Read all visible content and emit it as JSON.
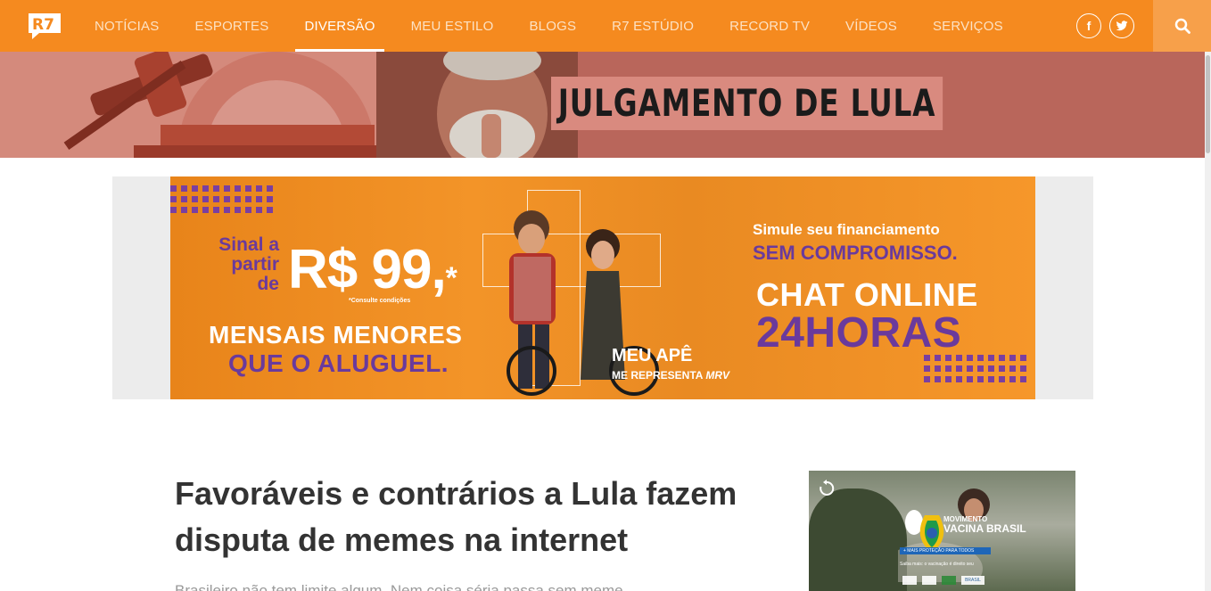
{
  "header": {
    "logo_text": "R7",
    "nav": [
      {
        "label": "NOTÍCIAS",
        "active": false
      },
      {
        "label": "ESPORTES",
        "active": false
      },
      {
        "label": "DIVERSÃO",
        "active": true
      },
      {
        "label": "MEU ESTILO",
        "active": false
      },
      {
        "label": "BLOGS",
        "active": false
      },
      {
        "label": "R7 ESTÚDIO",
        "active": false
      },
      {
        "label": "RECORD TV",
        "active": false
      },
      {
        "label": "VÍDEOS",
        "active": false
      },
      {
        "label": "SERVIÇOS",
        "active": false
      }
    ],
    "social": {
      "facebook": "f",
      "twitter": "twitter-icon"
    },
    "search_icon": "search-icon",
    "colors": {
      "bar": "#f58a1f",
      "search_box": "#f7a04a"
    }
  },
  "hero": {
    "title": "JULGAMENTO DE LULA",
    "color": "#b9665b"
  },
  "ad": {
    "sinal": "Sinal a partir de",
    "price": "R$ 99,",
    "price_mark": "*",
    "consulte": "*Consulte condições",
    "mensais": "MENSAIS MENORES",
    "aluguel": "QUE O ALUGUEL.",
    "simule": "Simule seu financiamento",
    "sem_compromisso": "SEM COMPROMISSO.",
    "chat": "CHAT ONLINE",
    "horas": "24HORAS",
    "brand_line1": "MEU APÊ",
    "brand_line2": "ME REPRESENTA",
    "brand_logo": "MRV",
    "colors": {
      "orange": "#f7931e",
      "purple": "#6a3a9c"
    }
  },
  "article": {
    "headline": "Favoráveis e contrários a Lula fazem disputa de memes na internet",
    "lead": "Brasileiro não tem limite algum. Nem coisa séria passa sem meme"
  },
  "video": {
    "caption_title": "VACINA BRASIL",
    "caption_pre": "MOVIMENTO",
    "band": "+ MAIS PROTEÇÃO PARA TODOS",
    "small": "Saiba mais: o vacinação é direito seu",
    "brand": "BRASIL",
    "replay_icon": "replay-icon"
  }
}
